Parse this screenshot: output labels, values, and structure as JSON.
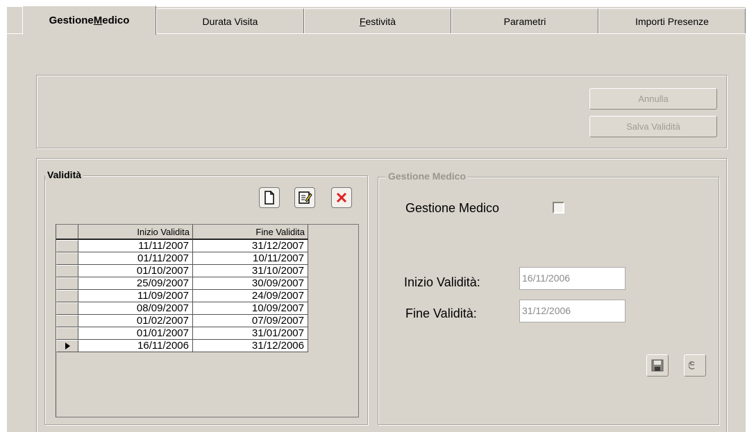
{
  "tabs": [
    {
      "pre": "Gestione ",
      "ul": "M",
      "post": "edico"
    },
    {
      "pre": "Durata Visita",
      "ul": "",
      "post": ""
    },
    {
      "pre": "",
      "ul": "F",
      "post": "estività"
    },
    {
      "pre": "Parametri",
      "ul": "",
      "post": ""
    },
    {
      "pre": "Importi Presenze",
      "ul": "",
      "post": ""
    }
  ],
  "top_panel": {
    "annulla": "Annulla",
    "salva_validita": "Salva Validità"
  },
  "validita": {
    "legend": "Validità",
    "toolbar": {
      "new_icon": "new-document-icon",
      "edit_icon": "edit-icon",
      "delete_icon": "delete-x-icon"
    },
    "columns": [
      "Inizio Validita",
      "Fine Validita"
    ],
    "rows": [
      [
        "11/11/2007",
        "31/12/2007"
      ],
      [
        "01/11/2007",
        "10/11/2007"
      ],
      [
        "01/10/2007",
        "31/10/2007"
      ],
      [
        "25/09/2007",
        "30/09/2007"
      ],
      [
        "11/09/2007",
        "24/09/2007"
      ],
      [
        "08/09/2007",
        "10/09/2007"
      ],
      [
        "01/02/2007",
        "07/09/2007"
      ],
      [
        "01/01/2007",
        "31/01/2007"
      ],
      [
        "16/11/2006",
        "31/12/2006"
      ]
    ],
    "current_row": 8
  },
  "gestione": {
    "legend": "Gestione Medico",
    "checkbox_label": "Gestione Medico",
    "checked": false,
    "inizio_label": "Inizio Validità:",
    "inizio_value": "16/11/2006",
    "fine_label": "Fine Validità:",
    "fine_value": "31/12/2006",
    "save_icon": "save-disk-icon",
    "undo_icon": "undo-icon"
  }
}
